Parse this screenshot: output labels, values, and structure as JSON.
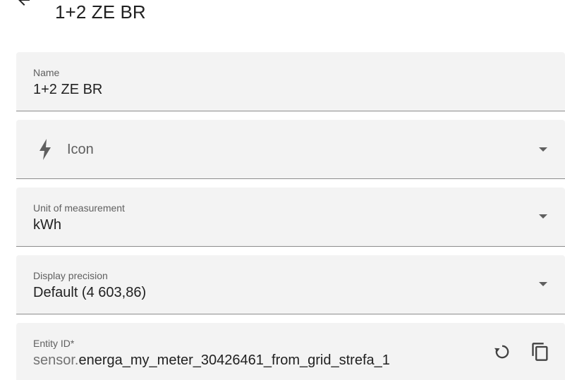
{
  "header": {
    "title": "1+2 ZE BR"
  },
  "fields": {
    "name": {
      "label": "Name",
      "value": "1+2 ZE BR"
    },
    "icon": {
      "placeholder": "Icon",
      "icon": "lightning-bolt-icon"
    },
    "unit": {
      "label": "Unit of measurement",
      "value": "kWh"
    },
    "precision": {
      "label": "Display precision",
      "value": "Default (4 603,86)"
    },
    "entity_id": {
      "label": "Entity ID*",
      "prefix": "sensor.",
      "value": "energa_my_meter_30426461_from_grid_strefa_1"
    }
  },
  "icons": {
    "back": "arrow-left-icon",
    "regenerate": "restore-icon",
    "copy": "copy-icon",
    "dropdown": "chevron-down-icon"
  },
  "colors": {
    "field_bg": "#f3f3f3",
    "text": "#212121",
    "label": "#5f5f5f"
  }
}
